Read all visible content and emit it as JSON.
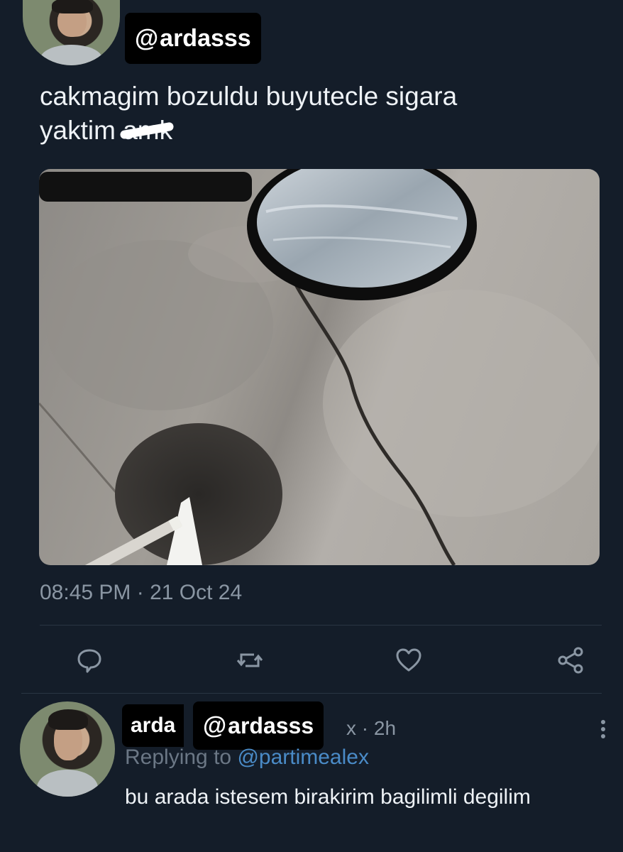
{
  "tweet": {
    "handle": "@ardasss",
    "text_line1": "cakmagim bozuldu buyutecle sigara",
    "text_line2": "yaktim",
    "scribbled_word": "amk",
    "timestamp": "08:45 PM · 21 Oct 24"
  },
  "actions": {
    "icons": [
      "reply-icon",
      "retweet-icon",
      "like-icon",
      "share-icon"
    ]
  },
  "reply": {
    "name": "arda",
    "handle": "@ardasss",
    "time_suffix": "x · 2h",
    "replying_prefix": "Replying to",
    "replying_mention": "@partimealex",
    "text": "bu arada istesem birakirim bagilimli degilim"
  },
  "colors": {
    "background": "#141d29",
    "link": "#4a8bc7",
    "muted": "#8a96a3"
  }
}
